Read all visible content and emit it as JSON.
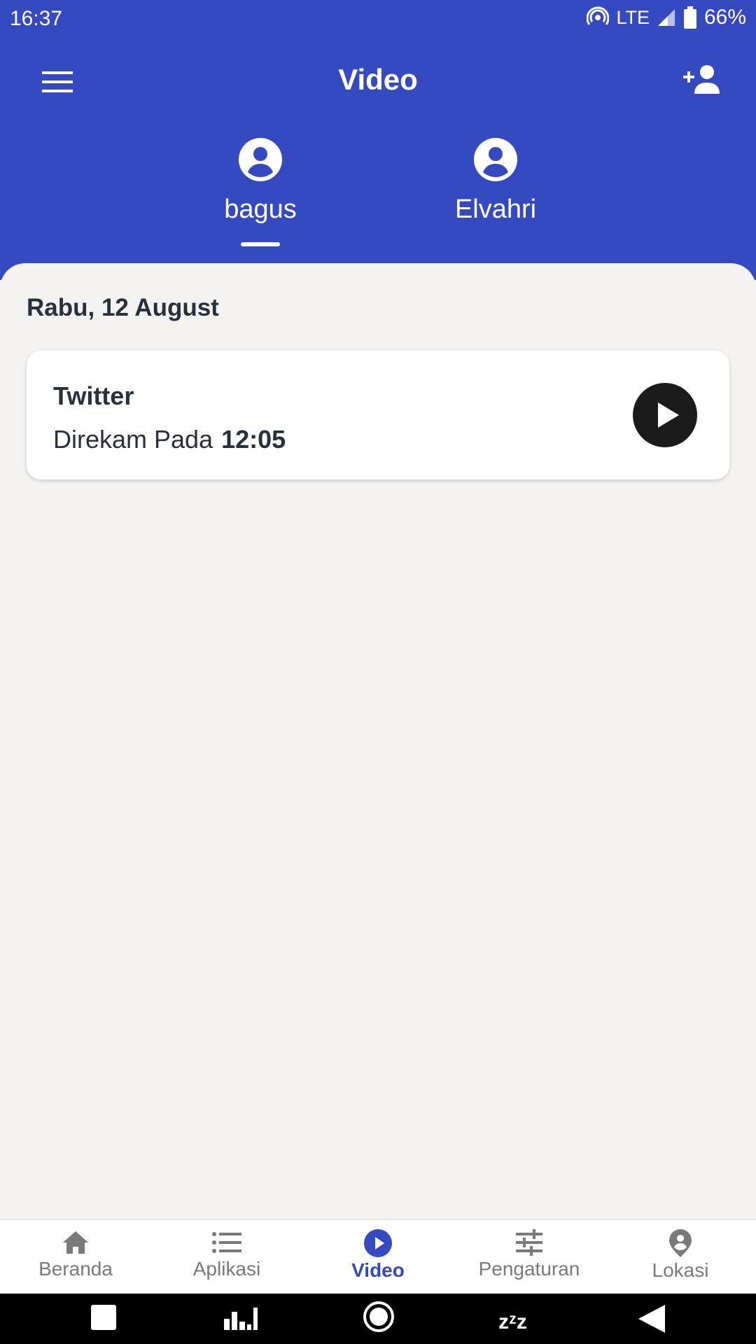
{
  "status_bar": {
    "time": "16:37",
    "network": "LTE",
    "battery": "66%"
  },
  "toolbar": {
    "title": "Video",
    "menu_icon": "hamburger-menu-icon",
    "add_icon": "add-person-icon"
  },
  "profiles": [
    {
      "name": "bagus",
      "selected": true
    },
    {
      "name": "Elvahri",
      "selected": false
    }
  ],
  "content": {
    "date": "Rabu, 12 August",
    "recordings": [
      {
        "app": "Twitter",
        "label": "Direkam Pada",
        "time": "12:05"
      }
    ]
  },
  "bottom_nav": {
    "items": [
      {
        "label": "Beranda",
        "icon": "home-icon"
      },
      {
        "label": "Aplikasi",
        "icon": "list-icon"
      },
      {
        "label": "Video",
        "icon": "play-circle-icon",
        "active": true
      },
      {
        "label": "Pengaturan",
        "icon": "sliders-icon"
      },
      {
        "label": "Lokasi",
        "icon": "location-pin-icon"
      }
    ]
  },
  "system_nav": {
    "sleep_text": "zᶻz"
  },
  "colors": {
    "primary": "#3549c1",
    "background": "#f4f3f1",
    "text": "#27303b",
    "inactive": "#7a7a7a"
  }
}
